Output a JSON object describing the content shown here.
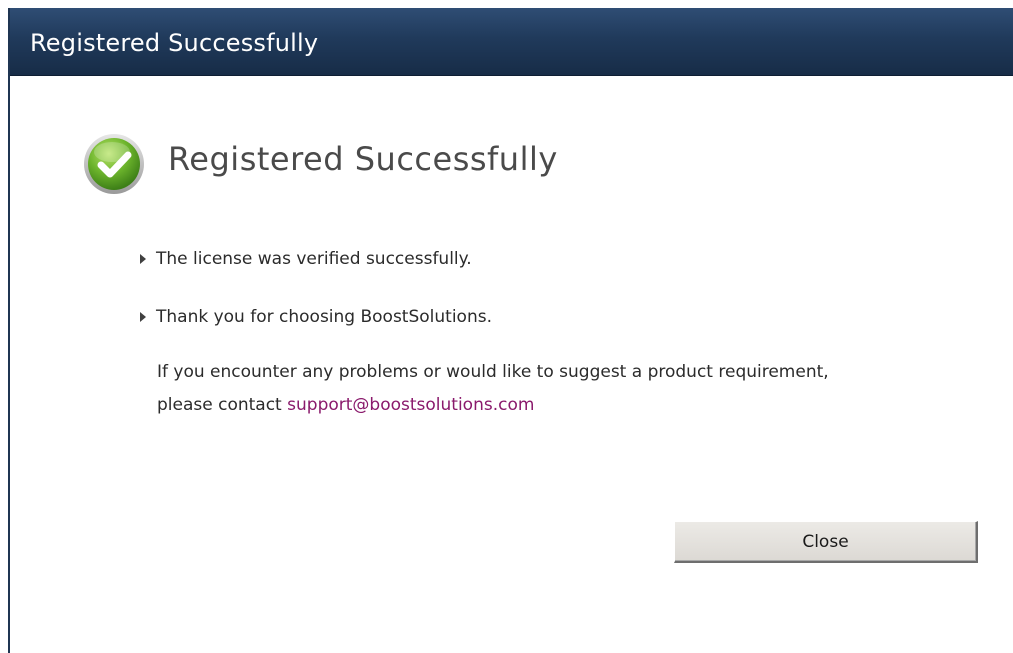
{
  "window": {
    "title": "Registered Successfully"
  },
  "content": {
    "heading": "Registered Successfully",
    "icon": "check-circle-icon",
    "accent_color": "#6cb42c",
    "bullets": [
      "The license was verified successfully.",
      "Thank you for choosing BoostSolutions."
    ],
    "message_line1": "If you encounter any problems or would like to suggest a product requirement,",
    "message_line2_prefix": "please contact ",
    "support_email": "support@boostsolutions.com",
    "link_color": "#8a1a6c"
  },
  "actions": {
    "close_label": "Close"
  }
}
